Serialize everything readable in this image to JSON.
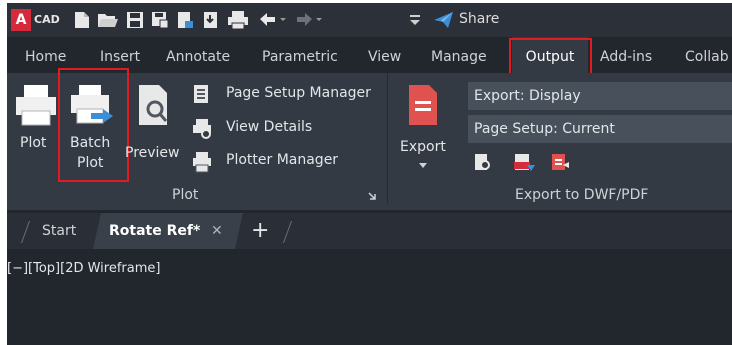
{
  "app": {
    "logo_letter": "A",
    "logo_text": "CAD"
  },
  "quick_access": {
    "share_label": "Share",
    "icons": [
      "new-icon",
      "open-icon",
      "save-icon",
      "save-as-icon",
      "upload-icon",
      "download-icon",
      "print-icon",
      "undo-icon",
      "redo-icon",
      "customize-icon",
      "share-icon"
    ]
  },
  "tabs": [
    "Home",
    "Insert",
    "Annotate",
    "Parametric",
    "View",
    "Manage",
    "Output",
    "Add-ins",
    "Collab"
  ],
  "active_tab": "Output",
  "plot_panel": {
    "title": "Plot",
    "plot_label": "Plot",
    "batch_plot_label_1": "Batch",
    "batch_plot_label_2": "Plot",
    "preview_label": "Preview",
    "page_setup_manager": "Page Setup Manager",
    "view_details": "View Details",
    "plotter_manager": "Plotter Manager"
  },
  "export_panel": {
    "title": "Export to DWF/PDF",
    "export_label": "Export",
    "export_dropdown": "Export: Display",
    "page_setup_dropdown": "Page Setup: Current"
  },
  "file_tabs": {
    "start": "Start",
    "active": "Rotate Ref*",
    "close": "✕",
    "add": "+"
  },
  "viewport": {
    "label": "[−][Top][2D Wireframe]"
  },
  "colors": {
    "accent_red": "#e11b22",
    "logo_red": "#d42a3a",
    "share_blue": "#3a8fd6"
  }
}
